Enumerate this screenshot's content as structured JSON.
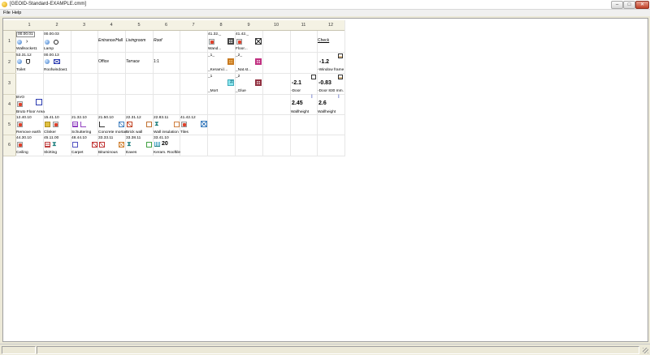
{
  "window": {
    "title": "[GEOID-Standard-EXAMPLE.cmm]",
    "min": "–",
    "max": "□",
    "close": "✕"
  },
  "menu": {
    "file": "File",
    "help": "Help"
  },
  "columns": [
    "1",
    "2",
    "3",
    "4",
    "5",
    "6",
    "7",
    "8",
    "9",
    "10",
    "11",
    "12"
  ],
  "rows": [
    "1",
    "2",
    "3",
    "4",
    "5",
    "6"
  ],
  "cells": {
    "r1c1": {
      "code": "00.00.01",
      "label": "Wallsocket1"
    },
    "r1c2": {
      "code": "00.00.03",
      "label": "Lamp"
    },
    "r1c4": {
      "text": "Entrance/Hall"
    },
    "r1c5": {
      "text": "Livingroom"
    },
    "r1c6": {
      "text": "Roof"
    },
    "r1c8": {
      "code": "41.32._",
      "label": "Wand..."
    },
    "r1c9": {
      "code": "41.42._",
      "label": "Floor..."
    },
    "r1c12": {
      "text": "Check"
    },
    "r2c1": {
      "code": "53.31.12",
      "label": "Toilet"
    },
    "r2c2": {
      "code": "00.00.13",
      "label": "Roofwindow1"
    },
    "r2c4": {
      "label": "Office"
    },
    "r2c5": {
      "text": "Terrace"
    },
    "r2c6": {
      "label": "1:1"
    },
    "r2c8": {
      "code": "_1_",
      "label": "_Kerami.l..."
    },
    "r2c9": {
      "code": "_2_",
      "label": "_Nat.st..."
    },
    "r2c12": {
      "num": "-1.2",
      "label": "-Window frame"
    },
    "r3c8": {
      "code": "_1",
      "label": "_Mort"
    },
    "r3c9": {
      "code": "_2",
      "label": "_Glue"
    },
    "r3c11": {
      "num": "-2.1",
      "label": "-Door"
    },
    "r3c12": {
      "num": "-0.83",
      "label": "-Door 830 mm."
    },
    "r4c1": {
      "code": "BVO",
      "label": "Bruto Floor Area"
    },
    "r4c11": {
      "num": "2.45",
      "label": "Wallheight"
    },
    "r4c12": {
      "num": "2.6",
      "label": "Wallheight"
    },
    "r5c1": {
      "code": "12.40.10",
      "label": "Remove earth"
    },
    "r5c2": {
      "code": "15.41.10",
      "label": "Clinker"
    },
    "r5c3": {
      "code": "21.32.10",
      "label": "Schuttering"
    },
    "r5c4": {
      "code": "21.50.10",
      "label": "Concrete mortar"
    },
    "r5c5": {
      "code": "22.31.12",
      "label": "Brick wall"
    },
    "r5c6": {
      "code": "22.83.11",
      "label": "Wall insulation"
    },
    "r5c7": {
      "code": "41.42.12",
      "label": "Tiles"
    },
    "r6c1": {
      "code": "44.30.10",
      "label": "Ceiling"
    },
    "r6c2": {
      "code": "45.11.00",
      "label": "Skirting"
    },
    "r6c3": {
      "code": "48.44.10",
      "label": "Carpet"
    },
    "r6c4": {
      "code": "33.33.11",
      "label": "Bituminous"
    },
    "r6c5": {
      "code": "33.38.11",
      "label": "Eaves"
    },
    "r6c6": {
      "code": "33.41.10",
      "label": "Keram. Rooftile",
      "num": "20"
    }
  }
}
